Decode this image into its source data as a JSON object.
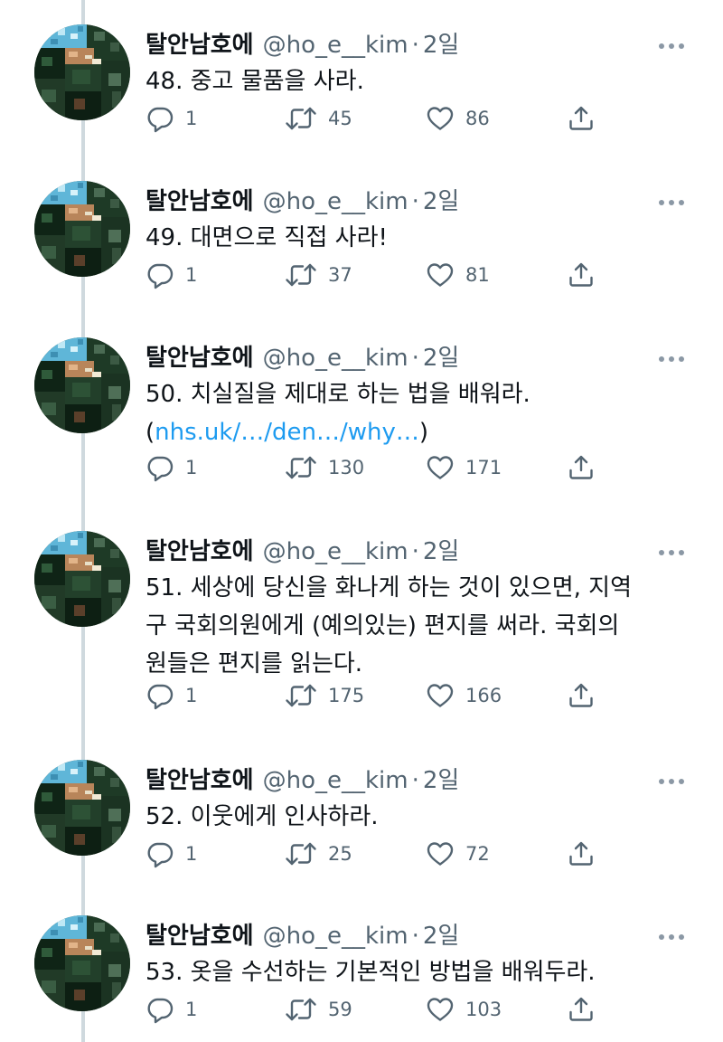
{
  "tweets": [
    {
      "name": "탈안남호에",
      "handle": "@ho_e__kim",
      "separator": "·",
      "time": "2일",
      "lines": [
        "48. 중고 물품을 사라."
      ],
      "link": null,
      "replies": "1",
      "retweets": "45",
      "likes": "86"
    },
    {
      "name": "탈안남호에",
      "handle": "@ho_e__kim",
      "separator": "·",
      "time": "2일",
      "lines": [
        "49. 대면으로 직접 사라!"
      ],
      "link": null,
      "replies": "1",
      "retweets": "37",
      "likes": "81"
    },
    {
      "name": "탈안남호에",
      "handle": "@ho_e__kim",
      "separator": "·",
      "time": "2일",
      "lines": [
        "50. 치실질을 제대로 하는 법을 배워라."
      ],
      "link": {
        "open": "(",
        "text": "nhs.uk/…/den…/why…",
        "close": ")"
      },
      "replies": "1",
      "retweets": "130",
      "likes": "171"
    },
    {
      "name": "탈안남호에",
      "handle": "@ho_e__kim",
      "separator": "·",
      "time": "2일",
      "lines": [
        "51. 세상에 당신을 화나게 하는 것이 있으면, 지역",
        "구 국회의원에게 (예의있는) 편지를 써라. 국회의",
        "원들은 편지를 읽는다."
      ],
      "link": null,
      "replies": "1",
      "retweets": "175",
      "likes": "166"
    },
    {
      "name": "탈안남호에",
      "handle": "@ho_e__kim",
      "separator": "·",
      "time": "2일",
      "lines": [
        "52. 이웃에게 인사하라."
      ],
      "link": null,
      "replies": "1",
      "retweets": "25",
      "likes": "72"
    },
    {
      "name": "탈안남호에",
      "handle": "@ho_e__kim",
      "separator": "·",
      "time": "2일",
      "lines": [
        "53. 옷을 수선하는 기본적인 방법을 배워두라."
      ],
      "link": null,
      "replies": "1",
      "retweets": "59",
      "likes": "103"
    }
  ],
  "icons": {
    "more": "more-dots-icon",
    "reply": "reply-bubble-icon",
    "retweet": "retweet-icon",
    "like": "heart-icon",
    "share": "share-icon"
  },
  "colors": {
    "text": "#0f1419",
    "secondary": "#536471",
    "link": "#1d9bf0",
    "thread_line": "#cfd9de"
  }
}
